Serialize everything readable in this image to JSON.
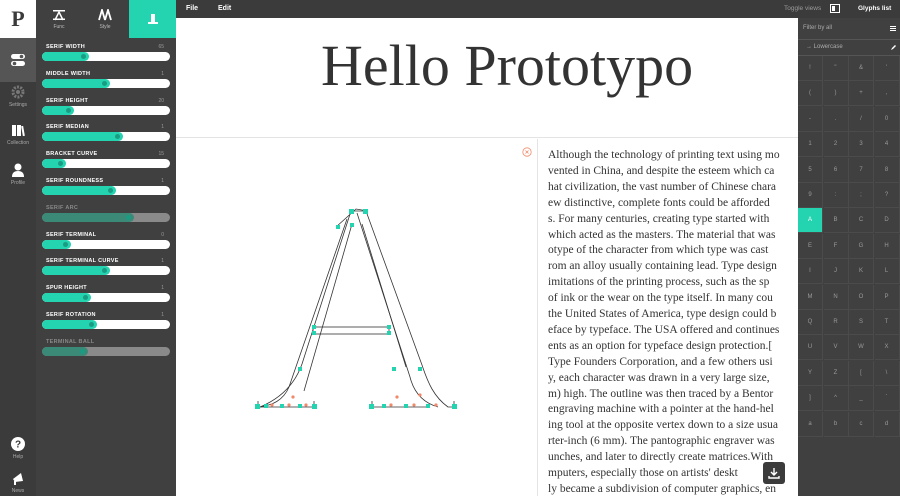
{
  "sidebar_rail": {
    "logo": "P",
    "items": [
      {
        "label": ""
      },
      {
        "label": "Settings"
      },
      {
        "label": "Collection"
      },
      {
        "label": "Profile"
      },
      {
        "label": "Help"
      },
      {
        "label": "News"
      }
    ]
  },
  "panel": {
    "tabs": [
      {
        "label": "Func"
      },
      {
        "label": "Style"
      },
      {
        "label": ""
      }
    ],
    "sliders": [
      {
        "name": "SERIF WIDTH",
        "value": "65",
        "level": 0.37,
        "disabled": false
      },
      {
        "name": "MIDDLE WIDTH",
        "value": "1",
        "level": 0.53,
        "disabled": false
      },
      {
        "name": "SERIF HEIGHT",
        "value": "20",
        "level": 0.25,
        "disabled": false
      },
      {
        "name": "SERIF MEDIAN",
        "value": "1",
        "level": 0.63,
        "disabled": false
      },
      {
        "name": "BRACKET CURVE",
        "value": "15",
        "level": 0.19,
        "disabled": false
      },
      {
        "name": "SERIF ROUNDNESS",
        "value": "1",
        "level": 0.58,
        "disabled": false
      },
      {
        "name": "SERIF ARC",
        "value": "",
        "level": 0.72,
        "disabled": true
      },
      {
        "name": "SERIF TERMINAL",
        "value": "0",
        "level": 0.23,
        "disabled": false
      },
      {
        "name": "SERIF TERMINAL CURVE",
        "value": "1",
        "level": 0.53,
        "disabled": false
      },
      {
        "name": "SPUR HEIGHT",
        "value": "1",
        "level": 0.38,
        "disabled": false
      },
      {
        "name": "SERIF ROTATION",
        "value": "1",
        "level": 0.43,
        "disabled": false
      },
      {
        "name": "TERMINAL BALL",
        "value": "",
        "level": 0.36,
        "disabled": true
      }
    ]
  },
  "topbar": {
    "file": "File",
    "edit": "Edit",
    "toggle_views": "Toggle views",
    "glyphs_list": "Glyphs list"
  },
  "preview": {
    "title": "Hello Prototypo"
  },
  "paragraph": [
    "Although the technology of printing text using mo",
    "vented in China,  and despite the esteem which ca",
    "hat civilization,  the vast number of Chinese chara",
    "ew distinctive,  complete fonts could be afforded",
    "s. For many centuries,  creating type started with",
    "which acted as the masters. The material that was",
    "otype of the character from which type was cast",
    "rom an alloy usually containing lead. Type design",
    "imitations of the printing process,  such as the sp",
    "of ink or the wear on the type itself. In many cou",
    "the United States of America,  type design could b",
    "eface by typeface. The USA offered and continues",
    "ents as an option for typeface design protection.[",
    "Type Founders Corporation,  and a few others usi",
    "y,  each character was drawn in a very large size,",
    "m) high. The outline was then traced by a Bentor",
    "engraving machine with a pointer at the hand-hel",
    "ing tool at the opposite vertex down to a size usua",
    "rter-inch (6 mm). The pantographic engraver was",
    "unches,  and later to directly create matrices.With",
    "mputers,  especially those on artists' deskt",
    "ly became a subdivision of computer graphics,  en"
  ],
  "glyphs": {
    "filter": "Filter by all",
    "category": "Lowercase",
    "cells": [
      "!",
      "\"",
      "&",
      "'",
      "(",
      ")",
      "+",
      ",",
      "-",
      ".",
      "/",
      "0",
      "1",
      "2",
      "3",
      "4",
      "5",
      "6",
      "7",
      "8",
      "9",
      ":",
      ";",
      "?",
      "A",
      "B",
      "C",
      "D",
      "E",
      "F",
      "G",
      "H",
      "I",
      "J",
      "K",
      "L",
      "M",
      "N",
      "O",
      "P",
      "Q",
      "R",
      "S",
      "T",
      "U",
      "V",
      "W",
      "X",
      "Y",
      "Z",
      "[",
      "\\",
      "]",
      "^",
      "_",
      "`",
      "a",
      "b",
      "c",
      "d"
    ],
    "selected": "A"
  },
  "colors": {
    "accent": "#24d3b0",
    "dark": "#3b3b3b",
    "panel": "#404040"
  }
}
